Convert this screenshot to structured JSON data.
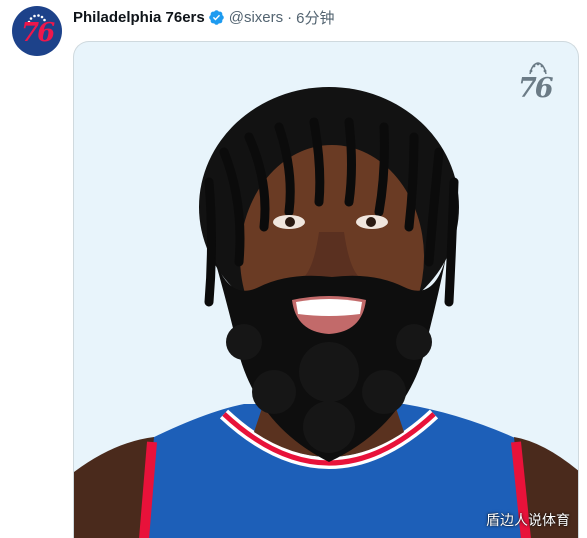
{
  "tweet": {
    "display_name": "Philadelphia 76ers",
    "handle": "@sixers",
    "separator": "·",
    "timestamp": "6分钟",
    "verified": true
  },
  "avatar": {
    "logo_text": "76",
    "background": "#1d428a",
    "accent": "#ed174c"
  },
  "media": {
    "logo_text": "76",
    "background": "#e8f4fb",
    "watermark": "盾边人说体育",
    "jersey_color": "#1d5fb8",
    "trim_color": "#e8123a"
  },
  "colors": {
    "verified": "#1d9bf0",
    "text_primary": "#0f1419",
    "text_secondary": "#536471"
  }
}
